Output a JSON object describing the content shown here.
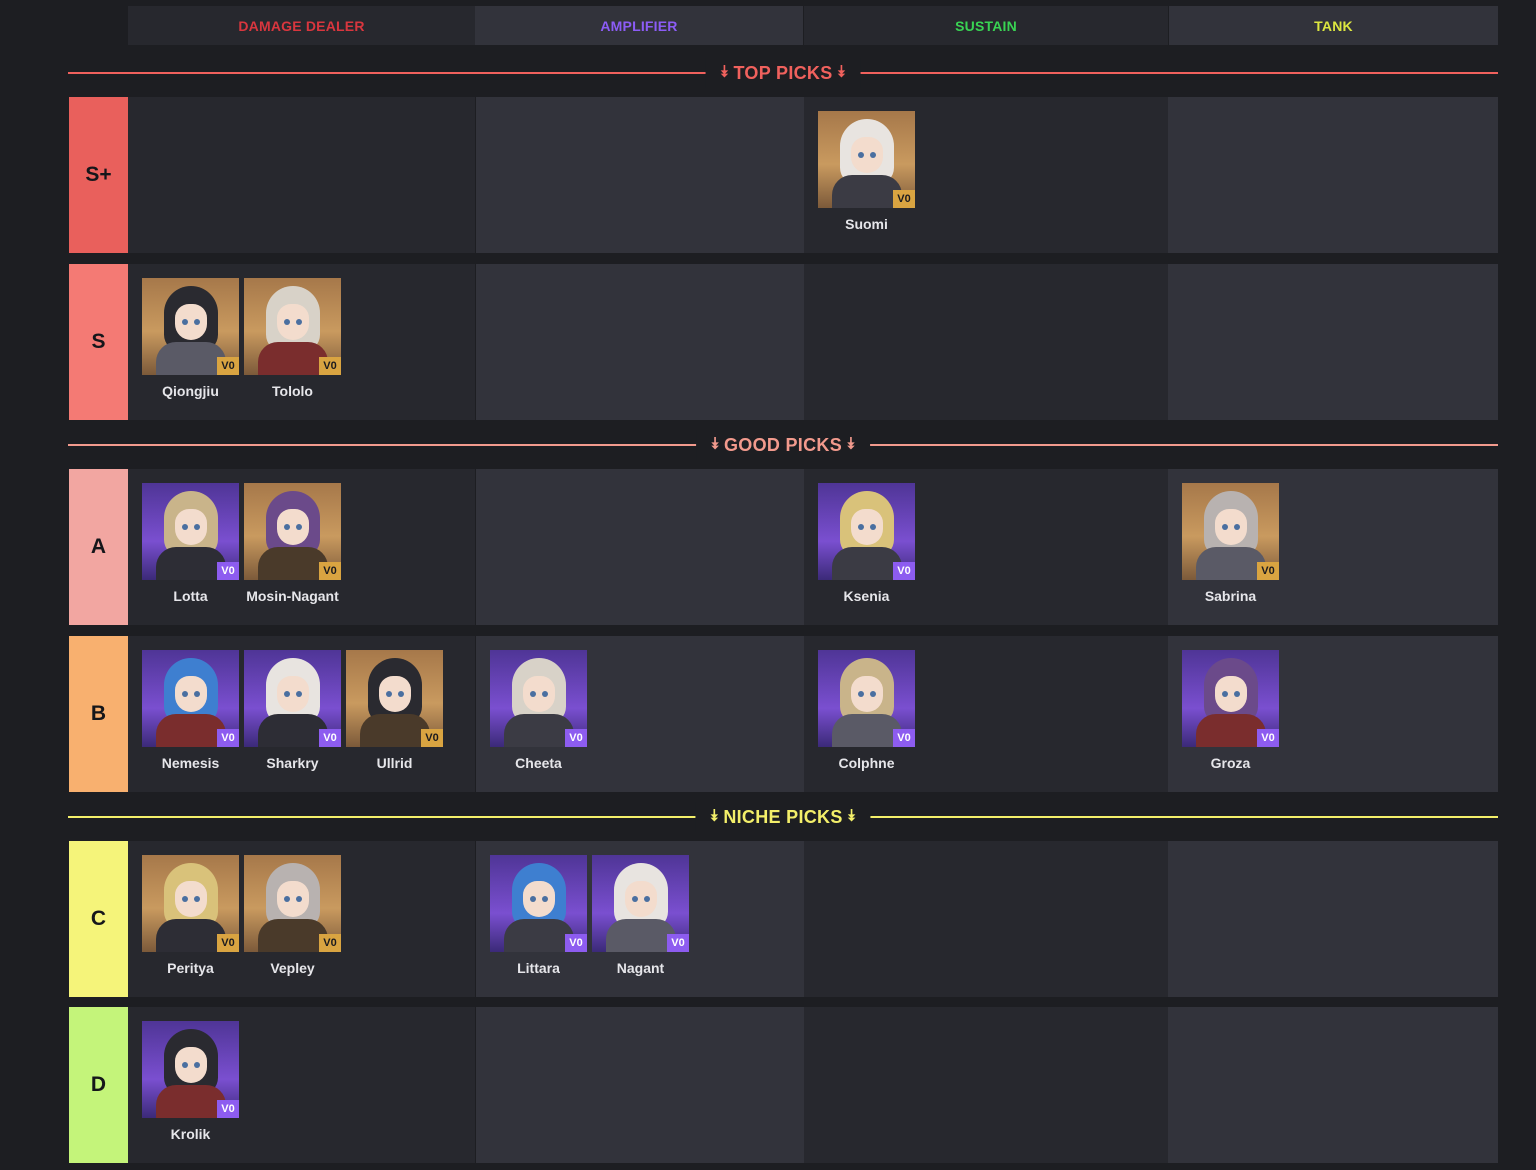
{
  "columns": [
    {
      "label": "DAMAGE DEALER",
      "color": "#d9363e"
    },
    {
      "label": "AMPLIFIER",
      "color": "#8c5cf6"
    },
    {
      "label": "SUSTAIN",
      "color": "#39d353"
    },
    {
      "label": "TANK",
      "color": "#dce640"
    }
  ],
  "sections": {
    "top": {
      "label": "TOP PICKS",
      "color": "#f0615d"
    },
    "good": {
      "label": "GOOD PICKS",
      "color": "#f29a8d"
    },
    "niche": {
      "label": "NICHE PICKS",
      "color": "#f3ef6a"
    }
  },
  "tiers": [
    {
      "label": "S+",
      "color": "#e9605c",
      "cells": [
        [],
        [],
        [
          {
            "name": "Suomi",
            "rarity": "gold"
          }
        ],
        []
      ]
    },
    {
      "label": "S",
      "color": "#f47a74",
      "cells": [
        [
          {
            "name": "Qiongjiu",
            "rarity": "gold"
          },
          {
            "name": "Tololo",
            "rarity": "gold"
          }
        ],
        [],
        [],
        []
      ]
    },
    {
      "label": "A",
      "color": "#f2a6a1",
      "cells": [
        [
          {
            "name": "Lotta",
            "rarity": "purple"
          },
          {
            "name": "Mosin-Nagant",
            "rarity": "gold"
          }
        ],
        [],
        [
          {
            "name": "Ksenia",
            "rarity": "purple"
          }
        ],
        [
          {
            "name": "Sabrina",
            "rarity": "gold"
          }
        ]
      ]
    },
    {
      "label": "B",
      "color": "#f8b06f",
      "cells": [
        [
          {
            "name": "Nemesis",
            "rarity": "purple"
          },
          {
            "name": "Sharkry",
            "rarity": "purple"
          },
          {
            "name": "Ullrid",
            "rarity": "gold"
          }
        ],
        [
          {
            "name": "Cheeta",
            "rarity": "purple"
          }
        ],
        [
          {
            "name": "Colphne",
            "rarity": "purple"
          }
        ],
        [
          {
            "name": "Groza",
            "rarity": "purple"
          }
        ]
      ]
    },
    {
      "label": "C",
      "color": "#f5f47a",
      "cells": [
        [
          {
            "name": "Peritya",
            "rarity": "gold"
          },
          {
            "name": "Vepley",
            "rarity": "gold"
          }
        ],
        [
          {
            "name": "Littara",
            "rarity": "purple"
          },
          {
            "name": "Nagant",
            "rarity": "purple"
          }
        ],
        [],
        []
      ]
    },
    {
      "label": "D",
      "color": "#c4f47a",
      "cells": [
        [
          {
            "name": "Krolik",
            "rarity": "purple"
          }
        ],
        [],
        [],
        []
      ]
    }
  ],
  "badge": "V0",
  "icons": {
    "section_chevron": "double-chevron-down-icon"
  }
}
